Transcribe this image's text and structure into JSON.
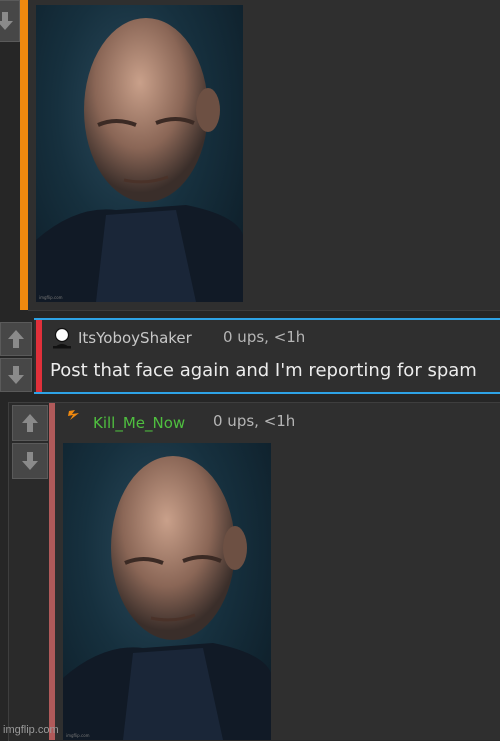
{
  "comments": [
    {
      "username": "",
      "score": "",
      "text": "",
      "has_image": true,
      "image_credit": "imgflip.com",
      "accent_color": "#f0890f"
    },
    {
      "username": "ItsYoboyShaker",
      "score": "0 ups, <1h",
      "text": "Post that face again and I'm reporting for spam",
      "has_image": false,
      "accent_color": "#e0303a",
      "avatar_icon": "person-silhouette-icon"
    },
    {
      "username": "Kill_Me_Now",
      "score": "0 ups, <1h",
      "text": "",
      "has_image": true,
      "image_credit": "imgflip.com",
      "accent_color": "#b05a5a",
      "username_color": "#4fbf3f",
      "avatar_icon": "lightning-badge-icon"
    }
  ],
  "colors": {
    "highlight_border": "#2ea3e6",
    "background": "#262626"
  },
  "watermark": "imgflip.com"
}
